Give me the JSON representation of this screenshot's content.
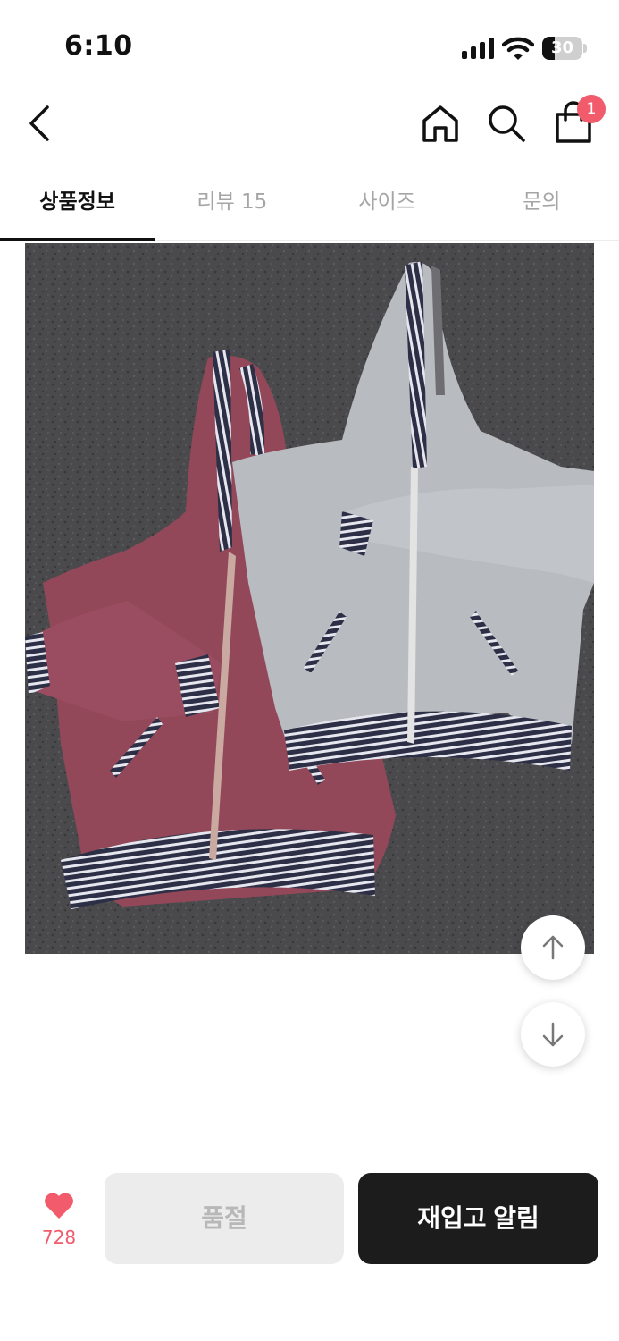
{
  "status_bar": {
    "time": "6:10",
    "battery_level": "30",
    "icons": [
      "signal-icon",
      "wifi-icon",
      "battery-icon"
    ]
  },
  "header": {
    "icons": [
      "back-arrow-icon",
      "home-icon",
      "search-icon",
      "shopping-bag-icon"
    ],
    "cart_count": "1"
  },
  "tabs": [
    {
      "label": "상품정보",
      "active": true
    },
    {
      "label": "리뷰 15",
      "active": false
    },
    {
      "label": "사이즈",
      "active": false
    },
    {
      "label": "문의",
      "active": false
    }
  ],
  "scroll_buttons": {
    "up_icon": "arrow-up-icon",
    "down_icon": "arrow-down-icon"
  },
  "bottom_bar": {
    "like_icon": "heart-icon",
    "like_count": "728",
    "soldout_label": "품절",
    "restock_label": "재입고 알림"
  },
  "colors": {
    "accent": "#f15b6c",
    "dark_button": "#1c1c1c",
    "disabled_button": "#ececec"
  }
}
